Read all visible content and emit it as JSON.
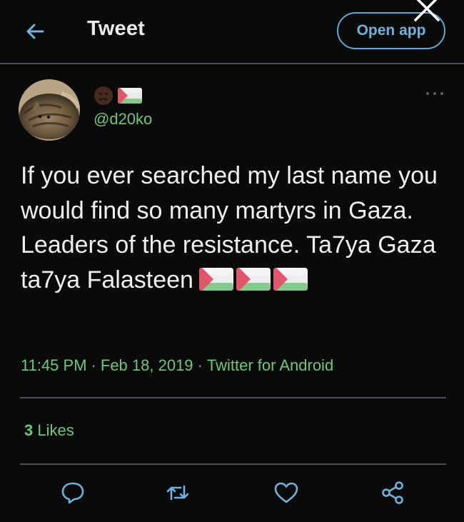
{
  "header": {
    "title": "Tweet",
    "open_app_label": "Open app",
    "back_icon": "arrow-left-icon",
    "close_icon": "close-icon"
  },
  "author": {
    "display_name_emoji": [
      "worried-face-emoji",
      "palestine-flag-emoji"
    ],
    "handle": "@d20ko"
  },
  "tweet": {
    "text": "If you ever searched my last name you would find so many martyrs in Gaza. Leaders of the resistance. Ta7ya Gaza ta7ya Falasteen",
    "trailing_emoji": [
      "palestine-flag-emoji",
      "palestine-flag-emoji",
      "palestine-flag-emoji"
    ],
    "time": "11:45 PM",
    "date": "Feb 18, 2019",
    "source": "Twitter for Android"
  },
  "stats": {
    "likes_count": "3",
    "likes_label": "Likes"
  },
  "actions": [
    "reply-icon",
    "retweet-icon",
    "like-icon",
    "share-icon"
  ],
  "colors": {
    "background": "#0a0a0a",
    "accent_green": "#6fc87a",
    "accent_blue": "#6db3dd",
    "divider": "#4a4f55"
  }
}
